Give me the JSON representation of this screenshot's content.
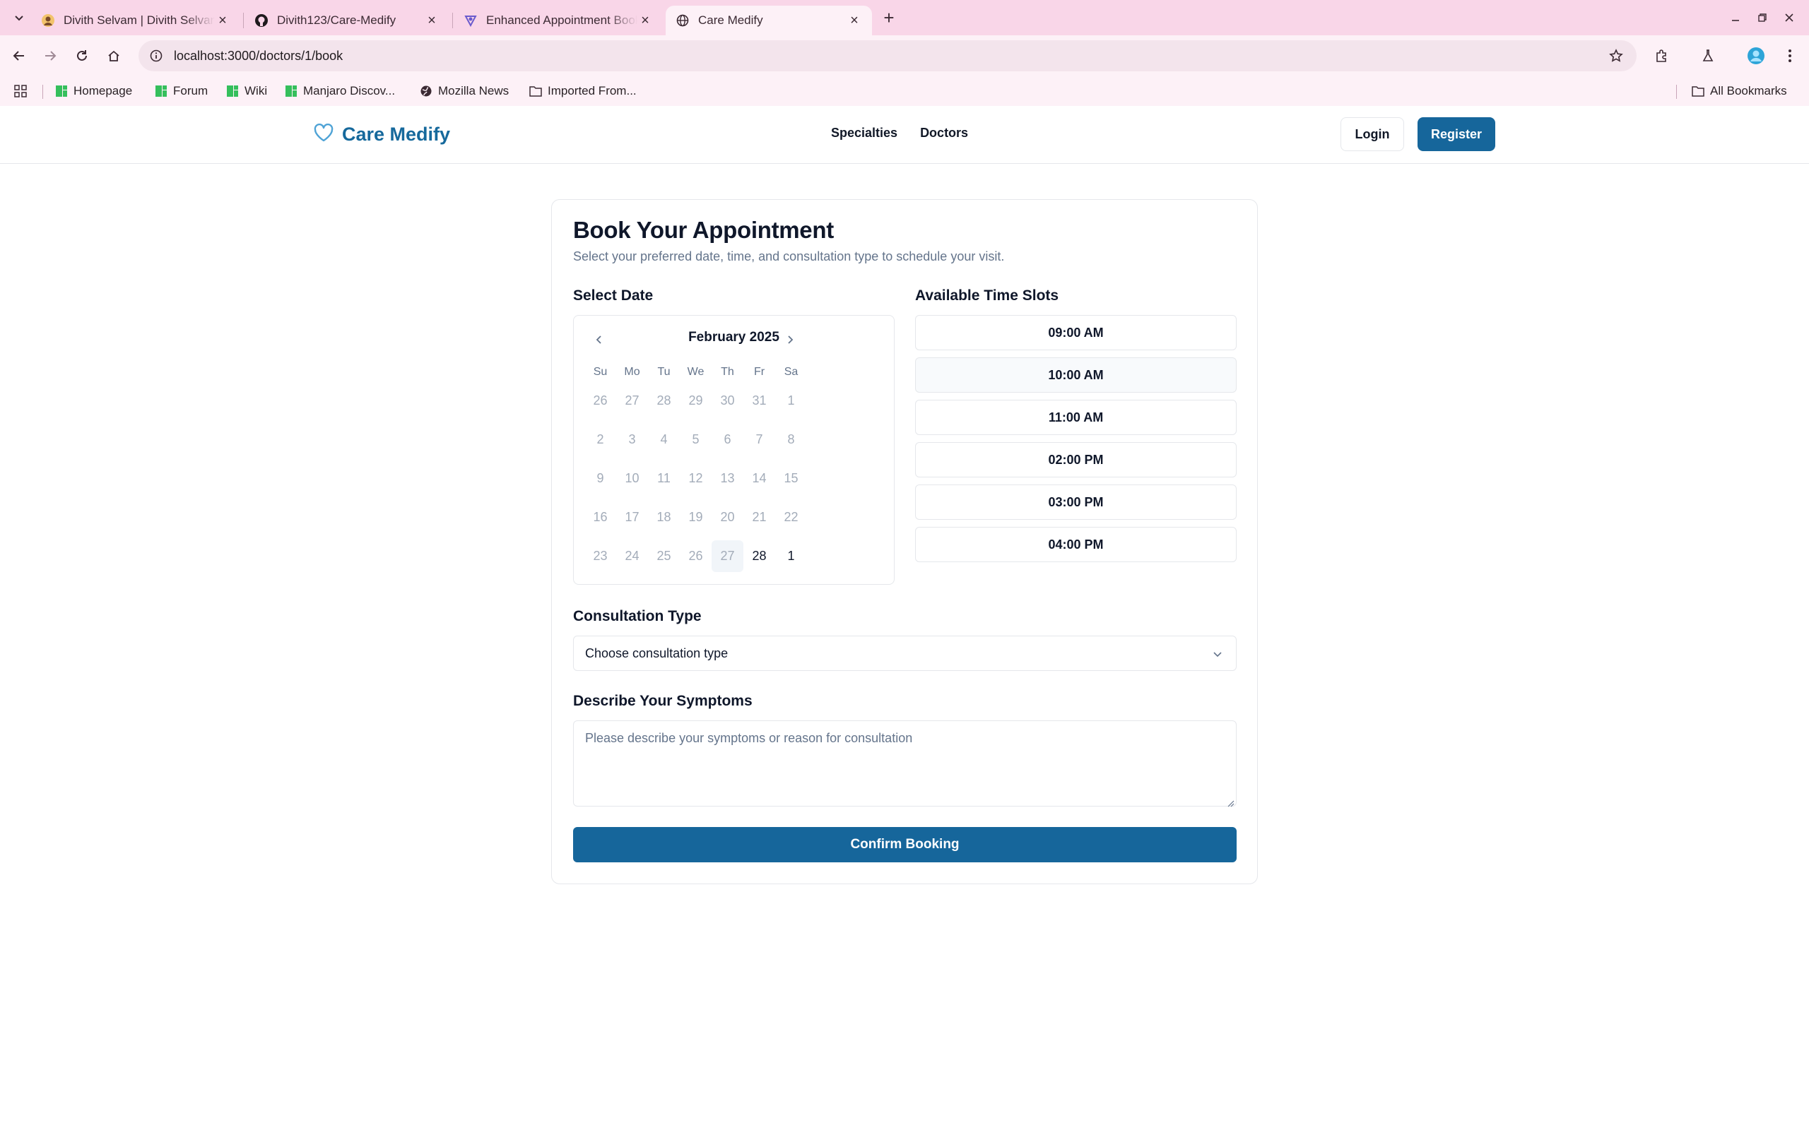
{
  "browser": {
    "tabs": [
      {
        "title": "Divith Selvam | Divith Selvam",
        "icon": "avatar-favicon-icon"
      },
      {
        "title": "Divith123/Care-Medify",
        "icon": "github-icon"
      },
      {
        "title": "Enhanced Appointment Booking",
        "icon": "app-logo-icon"
      },
      {
        "title": "Care Medify",
        "icon": "globe-icon",
        "active": true
      }
    ],
    "url": "localhost:3000/doctors/1/book",
    "bookmarks": [
      {
        "label": "Homepage",
        "icon": "manjaro-icon"
      },
      {
        "label": "Forum",
        "icon": "manjaro-icon"
      },
      {
        "label": "Wiki",
        "icon": "manjaro-icon"
      },
      {
        "label": "Manjaro Discov...",
        "icon": "manjaro-icon"
      },
      {
        "label": "Mozilla News",
        "icon": "globe-icon"
      },
      {
        "label": "Imported From...",
        "icon": "folder-icon"
      }
    ],
    "all_bookmarks": "All Bookmarks"
  },
  "site": {
    "brand": "Care Medify",
    "nav": [
      "Specialties",
      "Doctors"
    ],
    "login": "Login",
    "register": "Register",
    "brand_color": "#16699c"
  },
  "booking": {
    "title": "Book Your Appointment",
    "subtitle": "Select your preferred date, time, and consultation type to schedule your visit.",
    "date_label": "Select Date",
    "slots_label": "Available Time Slots",
    "calendar": {
      "month": "February 2025",
      "weekdays": [
        "Su",
        "Mo",
        "Tu",
        "We",
        "Th",
        "Fr",
        "Sa"
      ],
      "days": [
        "26",
        "27",
        "28",
        "29",
        "30",
        "31",
        "1",
        "2",
        "3",
        "4",
        "5",
        "6",
        "7",
        "8",
        "9",
        "10",
        "11",
        "12",
        "13",
        "14",
        "15",
        "16",
        "17",
        "18",
        "19",
        "20",
        "21",
        "22",
        "23",
        "24",
        "25",
        "26",
        "27",
        "28",
        "1"
      ],
      "today": "27",
      "enabled": [
        "28",
        "1"
      ]
    },
    "slots": [
      "09:00 AM",
      "10:00 AM",
      "11:00 AM",
      "02:00 PM",
      "03:00 PM",
      "04:00 PM"
    ],
    "consultation_label": "Consultation Type",
    "consultation_value": "Choose consultation type",
    "symptoms_label": "Describe Your Symptoms",
    "symptoms_placeholder": "Please describe your symptoms or reason for consultation",
    "confirm": "Confirm Booking",
    "accent_color": "#16669b"
  }
}
